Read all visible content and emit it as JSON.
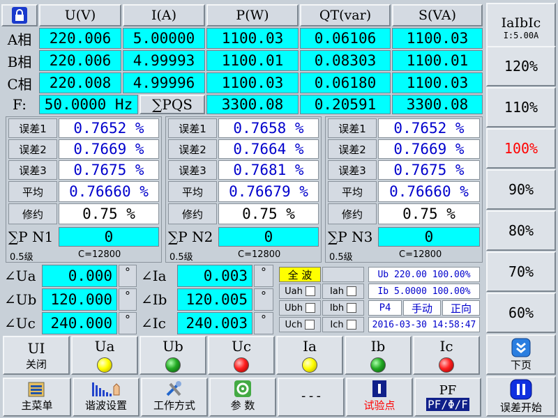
{
  "table": {
    "headers": [
      "U(V)",
      "I(A)",
      "P(W)",
      "QT(var)",
      "S(VA)"
    ],
    "rows": [
      {
        "label": "A相",
        "values": [
          "220.006",
          "5.00000",
          "1100.03",
          "0.06106",
          "1100.03"
        ]
      },
      {
        "label": "B相",
        "values": [
          "220.006",
          "4.99993",
          "1100.01",
          "0.08303",
          "1100.01"
        ]
      },
      {
        "label": "C相",
        "values": [
          "220.008",
          "4.99996",
          "1100.03",
          "0.06180",
          "1100.03"
        ]
      }
    ],
    "freq_label": "F:",
    "freq_value": "50.0000 Hz",
    "sum_label": "∑PQS",
    "sum_values": [
      "3300.08",
      "0.20591",
      "3300.08"
    ]
  },
  "error_panels": [
    {
      "rows": [
        {
          "label": "误差1",
          "value": "0.7652 %"
        },
        {
          "label": "误差2",
          "value": "0.7669 %"
        },
        {
          "label": "误差3",
          "value": "0.7675 %"
        },
        {
          "label": "平均",
          "value": "0.76660 %"
        },
        {
          "label": "修约",
          "value": "0.75 %"
        }
      ],
      "sum_label": "∑P N1",
      "sum_value": "0",
      "grade": "0.5级",
      "constant": "C=12800"
    },
    {
      "rows": [
        {
          "label": "误差1",
          "value": "0.7658 %"
        },
        {
          "label": "误差2",
          "value": "0.7664 %"
        },
        {
          "label": "误差3",
          "value": "0.7681 %"
        },
        {
          "label": "平均",
          "value": "0.76679 %"
        },
        {
          "label": "修约",
          "value": "0.75 %"
        }
      ],
      "sum_label": "∑P N2",
      "sum_value": "0",
      "grade": "0.5级",
      "constant": "C=12800"
    },
    {
      "rows": [
        {
          "label": "误差1",
          "value": "0.7652 %"
        },
        {
          "label": "误差2",
          "value": "0.7669 %"
        },
        {
          "label": "误差3",
          "value": "0.7675 %"
        },
        {
          "label": "平均",
          "value": "0.76660 %"
        },
        {
          "label": "修约",
          "value": "0.75 %"
        }
      ],
      "sum_label": "∑P N3",
      "sum_value": "0",
      "grade": "0.5级",
      "constant": "C=12800"
    }
  ],
  "angles": {
    "u": [
      {
        "label": "∠Ua",
        "value": "0.000"
      },
      {
        "label": "∠Ub",
        "value": "120.000"
      },
      {
        "label": "∠Uc",
        "value": "240.000"
      }
    ],
    "i": [
      {
        "label": "∠Ia",
        "value": "0.003"
      },
      {
        "label": "∠Ib",
        "value": "120.005"
      },
      {
        "label": "∠Ic",
        "value": "240.003"
      }
    ],
    "degree": "°"
  },
  "harmonics": {
    "mode": "全 波",
    "checks": [
      [
        "Uah",
        "Iah"
      ],
      [
        "Ubh",
        "Ibh"
      ],
      [
        "Uch",
        "Ich"
      ]
    ]
  },
  "info": {
    "ub": "Ub 220.00 100.00%",
    "ib": "Ib 5.0000 100.00%",
    "p": "P4",
    "manual": "手动",
    "direction": "正向",
    "datetime": "2016-03-30 14:58:47"
  },
  "right_panel": {
    "title": "IaIbIc",
    "subtitle": "I:5.00A",
    "levels": [
      "120%",
      "110%",
      "100%",
      "90%",
      "80%",
      "70%",
      "60%"
    ],
    "next_label": "下页",
    "start_label": "误差开始"
  },
  "status_row": {
    "ui_label": "UI",
    "ui_sub": "关闭",
    "leds": [
      {
        "label": "Ua",
        "color": "#ffff00"
      },
      {
        "label": "Ub",
        "color": "#22aa22"
      },
      {
        "label": "Uc",
        "color": "#ff2020"
      },
      {
        "label": "Ia",
        "color": "#ffff00"
      },
      {
        "label": "Ib",
        "color": "#22aa22"
      },
      {
        "label": "Ic",
        "color": "#ff2020"
      }
    ]
  },
  "menu": {
    "main": "主菜单",
    "harmonic": "谐波设置",
    "work_mode": "工作方式",
    "params": "参 数",
    "dashes": "---",
    "test_point": "试验点",
    "pf_top": "PF",
    "pf_bottom": "PF/Φ/F"
  },
  "colors": {
    "accent_cyan": "#00ffff",
    "active_red": "#ff0000",
    "info_blue": "#0000cc"
  }
}
